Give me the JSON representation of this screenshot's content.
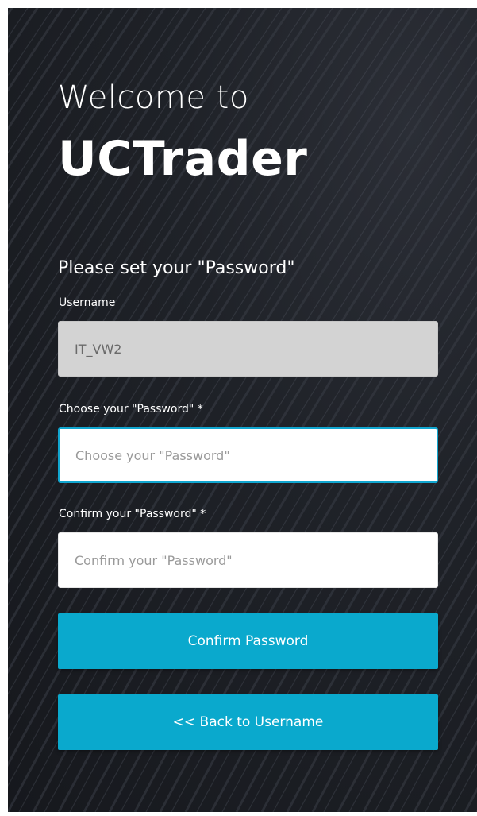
{
  "header": {
    "welcome": "Welcome to",
    "brand": "UCTrader"
  },
  "form": {
    "subtitle": "Please set your \"Password\"",
    "username_label": "Username",
    "username_value": "IT_VW2",
    "password_label": "Choose your \"Password\" *",
    "password_placeholder": "Choose your \"Password\"",
    "confirm_label": "Confirm your \"Password\" *",
    "confirm_placeholder": "Confirm your \"Password\"",
    "confirm_button": "Confirm Password",
    "back_button": "<< Back to Username"
  },
  "colors": {
    "background": "#1f2228",
    "accent": "#0aa9cd",
    "readonly_field": "#d3d3d3"
  }
}
